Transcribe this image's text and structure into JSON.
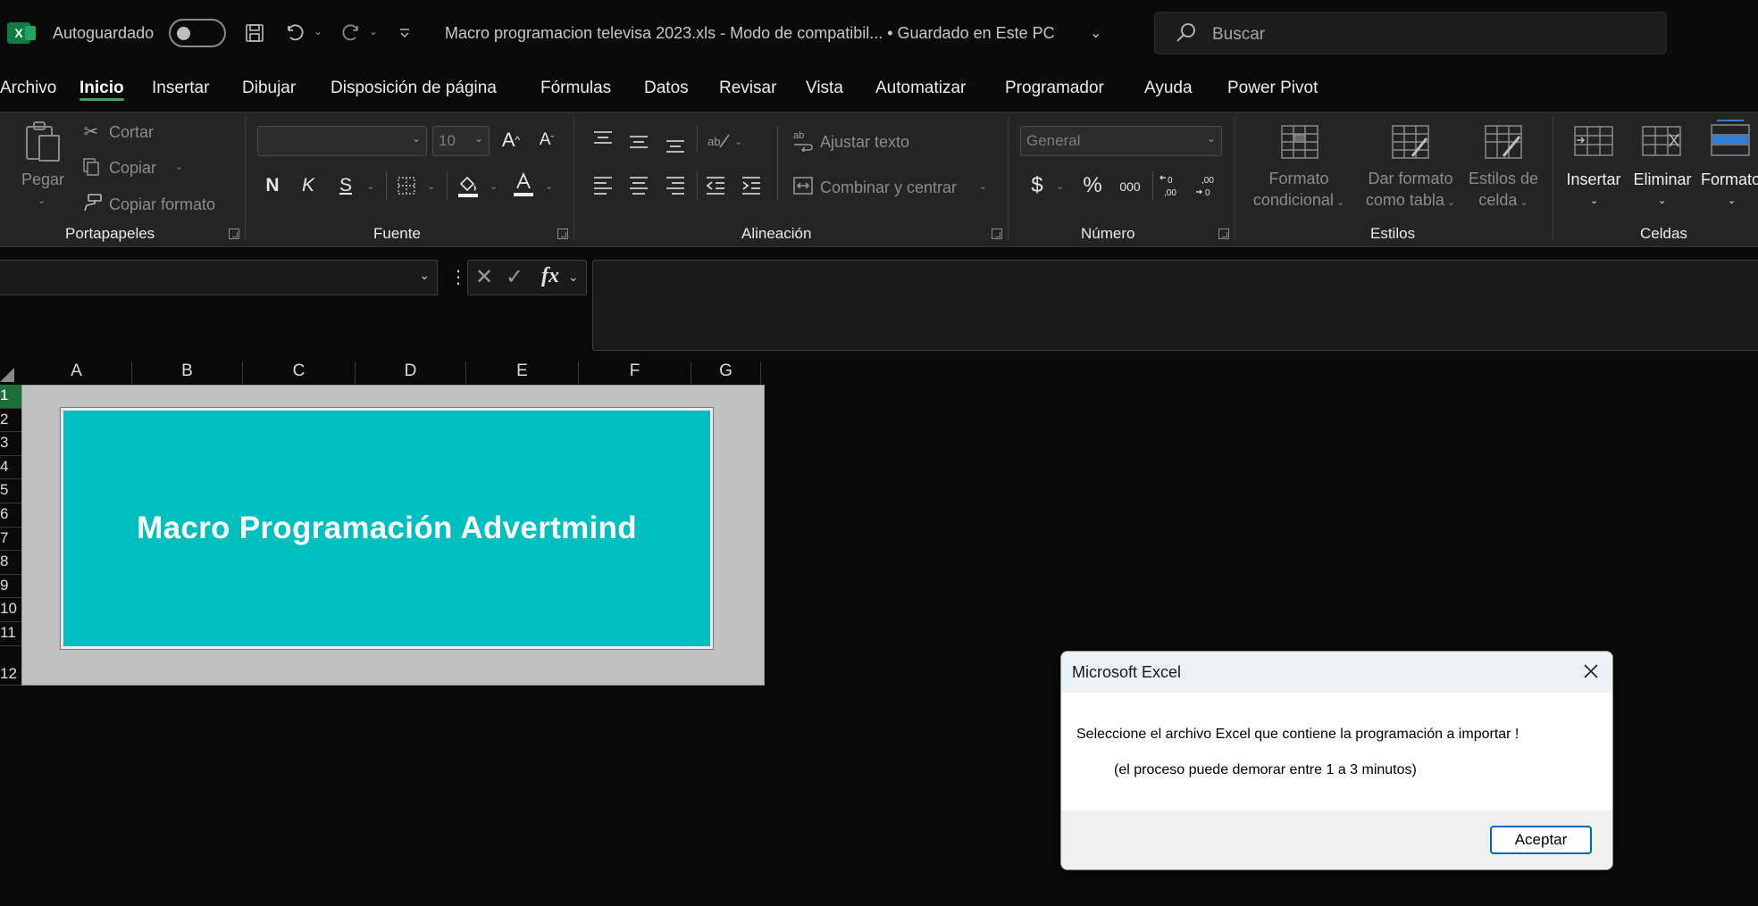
{
  "titlebar": {
    "autosave_label": "Autoguardado",
    "document_title": "Macro programacion televisa 2023.xls  -  Modo de compatibil...  •  Guardado en Este PC",
    "search_placeholder": "Buscar",
    "app_icon_letter": "X"
  },
  "menu": {
    "items": [
      "Archivo",
      "Inicio",
      "Insertar",
      "Dibujar",
      "Disposición de página",
      "Fórmulas",
      "Datos",
      "Revisar",
      "Vista",
      "Automatizar",
      "Programador",
      "Ayuda",
      "Power Pivot"
    ],
    "active": "Inicio"
  },
  "ribbon": {
    "clipboard": {
      "paste": "Pegar",
      "cut": "Cortar",
      "copy": "Copiar",
      "format_painter": "Copiar formato",
      "label": "Portapapeles"
    },
    "font": {
      "font_name": "",
      "font_size": "10",
      "bold": "N",
      "italic": "K",
      "underline": "S",
      "label": "Fuente"
    },
    "alignment": {
      "wrap_text": "Ajustar texto",
      "merge_center": "Combinar y centrar",
      "label": "Alineación"
    },
    "number": {
      "format": "General",
      "currency": "$",
      "percent": "%",
      "thousands": "000",
      "label": "Número"
    },
    "styles": {
      "conditional_1": "Formato",
      "conditional_2": "condicional",
      "table_1": "Dar formato",
      "table_2": "como tabla",
      "cell_1": "Estilos de",
      "cell_2": "celda",
      "label": "Estilos"
    },
    "cells": {
      "insert": "Insertar",
      "delete": "Eliminar",
      "format": "Formato",
      "label": "Celdas"
    }
  },
  "sheet": {
    "columns": [
      "A",
      "B",
      "C",
      "D",
      "E",
      "F",
      "G"
    ],
    "rows": [
      "1",
      "2",
      "3",
      "4",
      "5",
      "6",
      "7",
      "8",
      "9",
      "10",
      "11",
      "12"
    ],
    "banner_text": "Macro Programación Advertmind"
  },
  "dialog": {
    "title": "Microsoft Excel",
    "message_line1": "Seleccione el archivo Excel que contiene la programación a importar !",
    "message_line2": "(el proceso puede demorar entre 1 a 3 minutos)",
    "ok_button": "Aceptar"
  },
  "colors": {
    "accent": "#3fa55d",
    "banner": "#00bfbf",
    "excel_green": "#107c41"
  }
}
